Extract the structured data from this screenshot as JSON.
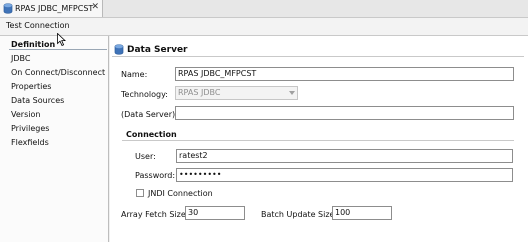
{
  "tab": {
    "title": "RPAS JDBC_MFPCST",
    "close_glyph": "✕",
    "icon": "database-icon"
  },
  "toolbar": {
    "test_connection_label": "Test Connection"
  },
  "nav": {
    "items": [
      {
        "label": "Definition",
        "selected": true
      },
      {
        "label": "JDBC"
      },
      {
        "label": "On Connect/Disconnect"
      },
      {
        "label": "Properties"
      },
      {
        "label": "Data Sources"
      },
      {
        "label": "Version"
      },
      {
        "label": "Privileges"
      },
      {
        "label": "Flexfields"
      }
    ]
  },
  "main": {
    "title": "Data Server",
    "name": {
      "label": "Name:",
      "value": "RPAS JDBC_MFPCST"
    },
    "technology": {
      "label": "Technology:",
      "value": "RPAS JDBC"
    },
    "data_server": {
      "label": "(Data Server):",
      "value": ""
    },
    "connection": {
      "title": "Connection",
      "user": {
        "label": "User:",
        "value": "ratest2"
      },
      "password": {
        "label": "Password:",
        "value": "•••••••••"
      },
      "jndi_label": "JNDI Connection"
    },
    "array_fetch": {
      "label": "Array Fetch Size:",
      "value": "30"
    },
    "batch_update": {
      "label": "Batch Update Size:",
      "value": "100"
    }
  },
  "colors": {
    "accent": "#3f73b8",
    "selection_line": "#9aa7b5"
  }
}
